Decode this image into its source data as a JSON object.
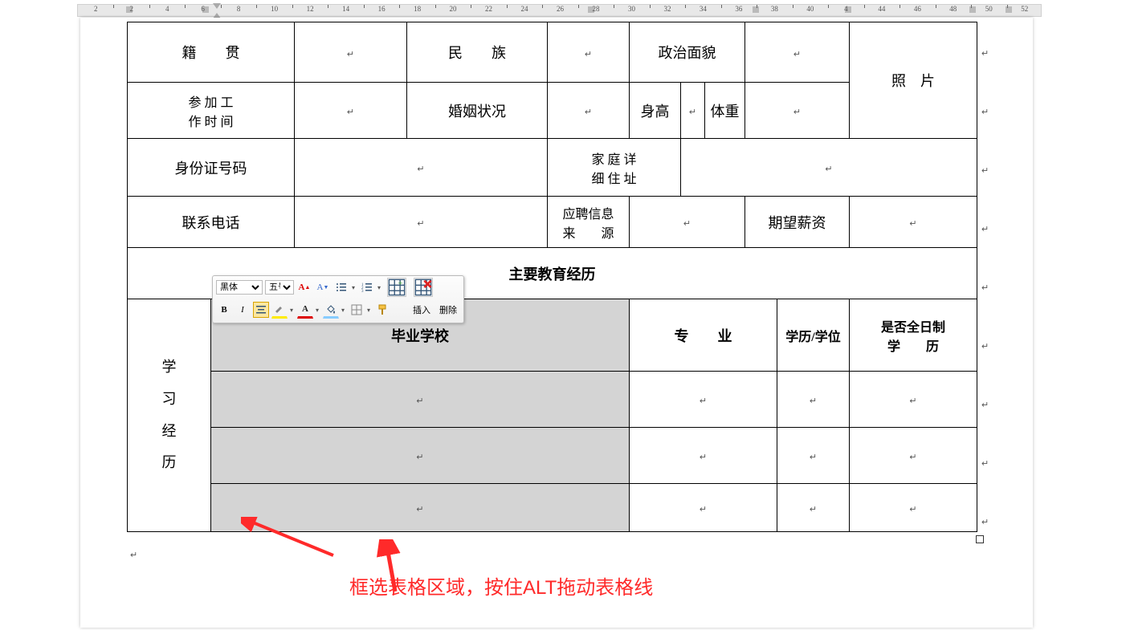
{
  "ruler": {
    "numbers": [
      2,
      2,
      4,
      6,
      8,
      10,
      12,
      14,
      16,
      18,
      20,
      22,
      24,
      26,
      28,
      30,
      32,
      34,
      36,
      38,
      40,
      4,
      44,
      46,
      48,
      50,
      52
    ]
  },
  "table": {
    "r1": {
      "c1": "籍　　贯",
      "c3": "民　　族",
      "c5": "政治面貌",
      "photo": "照　片"
    },
    "r2": {
      "c1": "参 加 工\n作 时 间",
      "c3": "婚姻状况",
      "c5": "身高",
      "c6": "体重"
    },
    "r3": {
      "c1": "身份证号码",
      "c3": "家 庭 详\n细 住 址"
    },
    "r4": {
      "c1": "联系电话",
      "c3": "应聘信息\n来　　源",
      "c5": "期望薪资"
    },
    "r5": {
      "title": "主要教育经历"
    },
    "r6": {
      "side": "学\n习\n经\n历",
      "c2": "毕业学校",
      "c3": "专　　业",
      "c4": "学历/学位",
      "c5": "是否全日制\n学　　历"
    }
  },
  "mini": {
    "font": "黑体",
    "size": "五号",
    "insert": "插入",
    "delete": "删除"
  },
  "annotation": "框选表格区域，按住ALT拖动表格线",
  "mark": "↵"
}
